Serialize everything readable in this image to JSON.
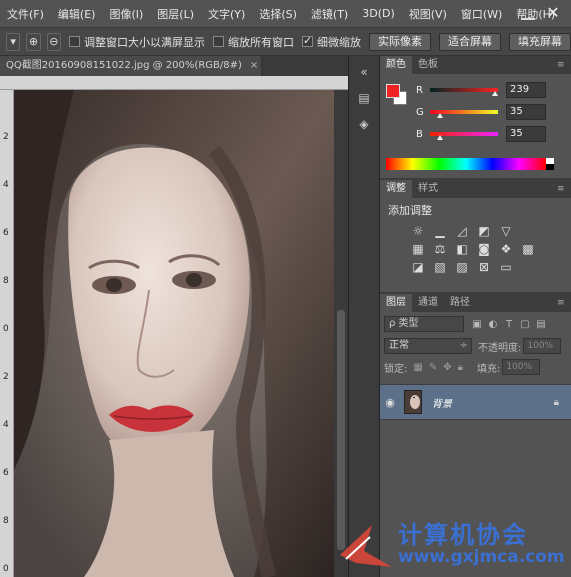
{
  "menu": [
    "文件(F)",
    "编辑(E)",
    "图像(I)",
    "图层(L)",
    "文字(Y)",
    "选择(S)",
    "滤镜(T)",
    "3D(D)",
    "视图(V)",
    "窗口(W)",
    "帮助(H)"
  ],
  "options": {
    "resize_windows": "调整窗口大小以满屏显示",
    "zoom_all": "缩放所有窗口",
    "scrubby_zoom": "细微缩放",
    "actual_pixels": "实际像素",
    "fit_screen": "适合屏幕",
    "fill_screen": "填充屏幕"
  },
  "document": {
    "tab": "QQ截图20160908151022.jpg @ 200%(RGB/8#)"
  },
  "ruler_numbers": [
    "2",
    "4",
    "6",
    "8",
    "0",
    "2",
    "4",
    "6",
    "8",
    "0"
  ],
  "color_panel": {
    "tabs": [
      "颜色",
      "色板"
    ],
    "foreground": "#ef2323",
    "background": "#ffffff",
    "r": {
      "label": "R",
      "value": "239"
    },
    "g": {
      "label": "G",
      "value": "35"
    },
    "b": {
      "label": "B",
      "value": "35"
    }
  },
  "adjust_panel": {
    "tabs": [
      "调整",
      "样式"
    ],
    "title": "添加调整"
  },
  "layers_panel": {
    "tabs": [
      "图层",
      "通道",
      "路径"
    ],
    "kind": "ρ 类型",
    "blend_mode": "正常",
    "opacity_label": "不透明度:",
    "opacity_value": "100%",
    "lock_label": "锁定:",
    "fill_label": "填充:",
    "fill_value": "100%",
    "layer_name": "背景"
  },
  "watermark": {
    "name": "计算机协会",
    "url": "www.gxjmca.com"
  }
}
